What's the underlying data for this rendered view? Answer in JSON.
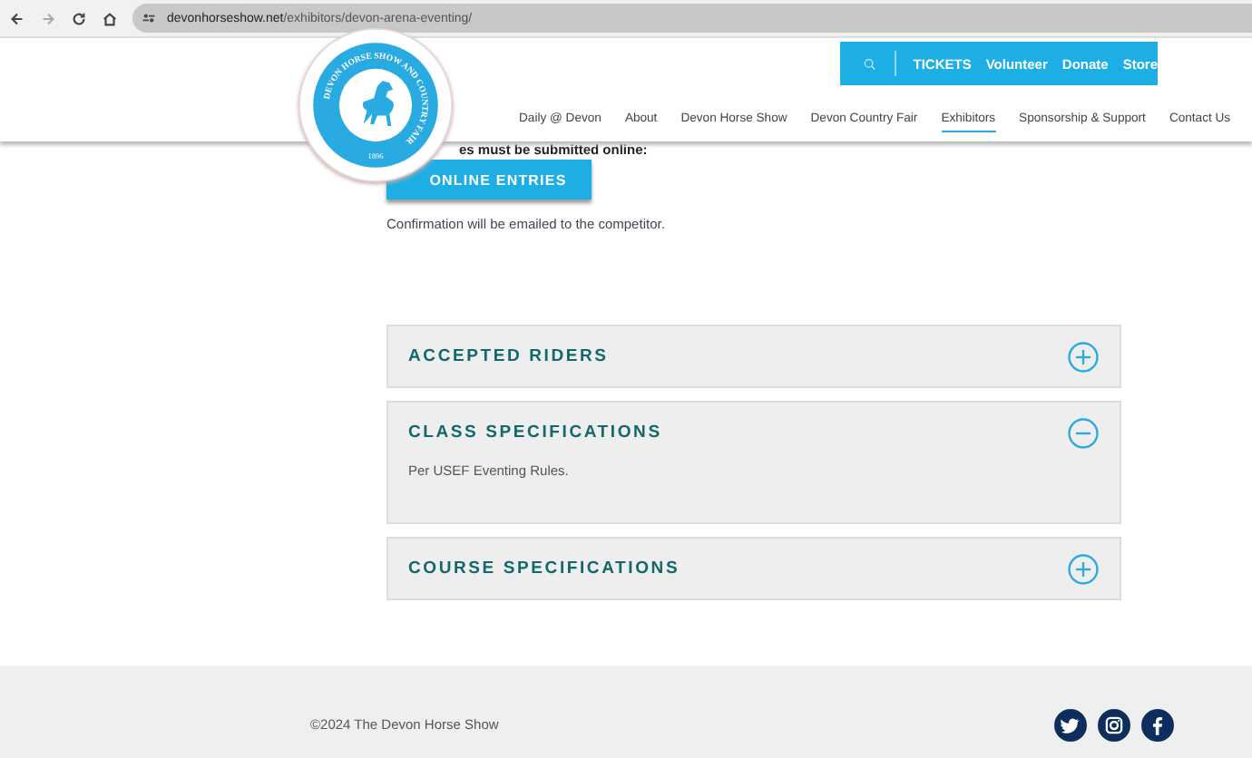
{
  "browser": {
    "url_host": "devonhorseshow.net",
    "url_path": "/exhibitors/devon-arena-eventing/"
  },
  "logo": {
    "ring_text": "DEVON HORSE SHOW AND COUNTRY FAIR",
    "year": "1896"
  },
  "utility_nav": [
    "TICKETS",
    "Volunteer",
    "Donate",
    "Store"
  ],
  "main_nav": [
    {
      "label": "Daily @ Devon",
      "selected": false
    },
    {
      "label": "About",
      "selected": false
    },
    {
      "label": "Devon Horse Show",
      "selected": false
    },
    {
      "label": "Devon Country Fair",
      "selected": false
    },
    {
      "label": "Exhibitors",
      "selected": true
    },
    {
      "label": "Sponsorship & Support",
      "selected": false
    },
    {
      "label": "Contact Us",
      "selected": false
    }
  ],
  "entries": {
    "note": "es must be submitted online:",
    "button": "ONLINE ENTRIES",
    "confirmation": "Confirmation will be emailed to the competitor."
  },
  "accordion": [
    {
      "title": "ACCEPTED RIDERS",
      "expanded": false
    },
    {
      "title": "CLASS SPECIFICATIONS",
      "expanded": true,
      "body": "Per USEF Eventing Rules."
    },
    {
      "title": "COURSE SPECIFICATIONS",
      "expanded": false
    }
  ],
  "footer": {
    "copyright": "©2024 The Devon Horse Show"
  }
}
